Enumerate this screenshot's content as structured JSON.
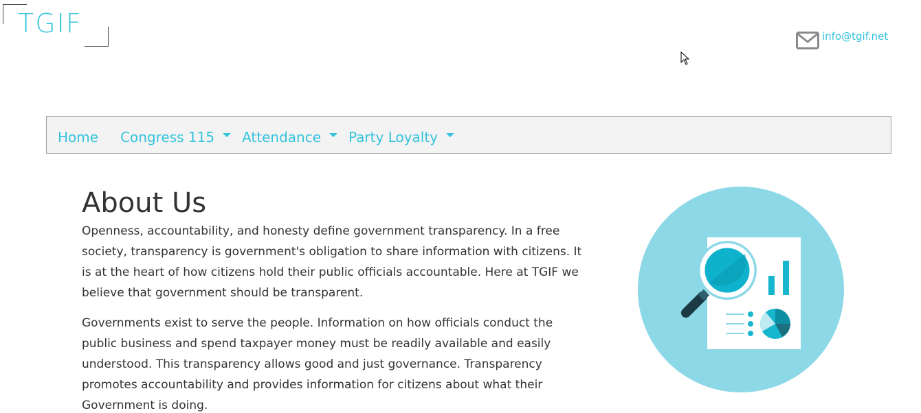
{
  "brand": {
    "logo_text": "TGIF"
  },
  "contact": {
    "email": "info@tgif.net",
    "icon": "envelope-icon"
  },
  "nav": {
    "items": [
      {
        "label": "Home",
        "has_dropdown": false
      },
      {
        "label": "Congress 115",
        "has_dropdown": true
      },
      {
        "label": "Attendance",
        "has_dropdown": true
      },
      {
        "label": "Party Loyalty",
        "has_dropdown": true
      }
    ]
  },
  "about": {
    "title": "About Us",
    "paragraphs": [
      "Openness, accountability, and honesty define government transparency. In a free society, transparency is government's obligation to share information with citizens. It is at the heart of how citizens hold their public officials accountable. Here at TGIF we believe that government should be transparent.",
      "Governments exist to serve the people. Information on how officials conduct the public business and spend taxpayer money must be readily available and easily understood. This transparency allows good and just governance. Transparency promotes accountability and provides information for citizens about what their Government is doing."
    ]
  },
  "illustration": {
    "icon": "magnifier-report-icon"
  },
  "colors": {
    "accent": "#35c3dd",
    "text": "#333333",
    "navbar_bg": "#f3f3f3",
    "circle_bg": "#8dd8e7"
  }
}
